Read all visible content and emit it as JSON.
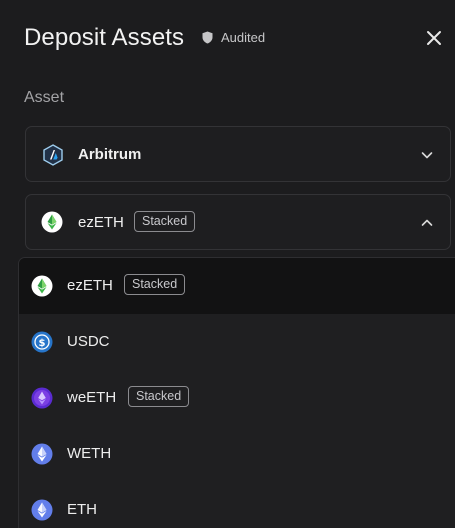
{
  "header": {
    "title": "Deposit Assets",
    "audited_label": "Audited"
  },
  "asset_section": {
    "label": "Asset"
  },
  "network_select": {
    "selected": "Arbitrum",
    "icon": "arbitrum-icon"
  },
  "token_select": {
    "selected": "ezETH",
    "badge": "Stacked",
    "icon": "ezeth-icon",
    "expanded": true
  },
  "options": [
    {
      "name": "ezETH",
      "badge": "Stacked",
      "icon": "ezeth-icon",
      "active": true
    },
    {
      "name": "USDC",
      "badge": "",
      "icon": "usdc-icon",
      "active": false
    },
    {
      "name": "weETH",
      "badge": "Stacked",
      "icon": "weeth-icon",
      "active": false
    },
    {
      "name": "WETH",
      "badge": "",
      "icon": "weth-icon",
      "active": false
    },
    {
      "name": "ETH",
      "badge": "",
      "icon": "eth-icon",
      "active": false
    }
  ],
  "colors": {
    "background": "#1c1c1e",
    "dropdown_active": "#121213",
    "border": "#333336",
    "usdc": "#2775ca",
    "eth": "#627eea",
    "weeth": "#7b3fe4",
    "ezeth": "#7bd36a"
  }
}
